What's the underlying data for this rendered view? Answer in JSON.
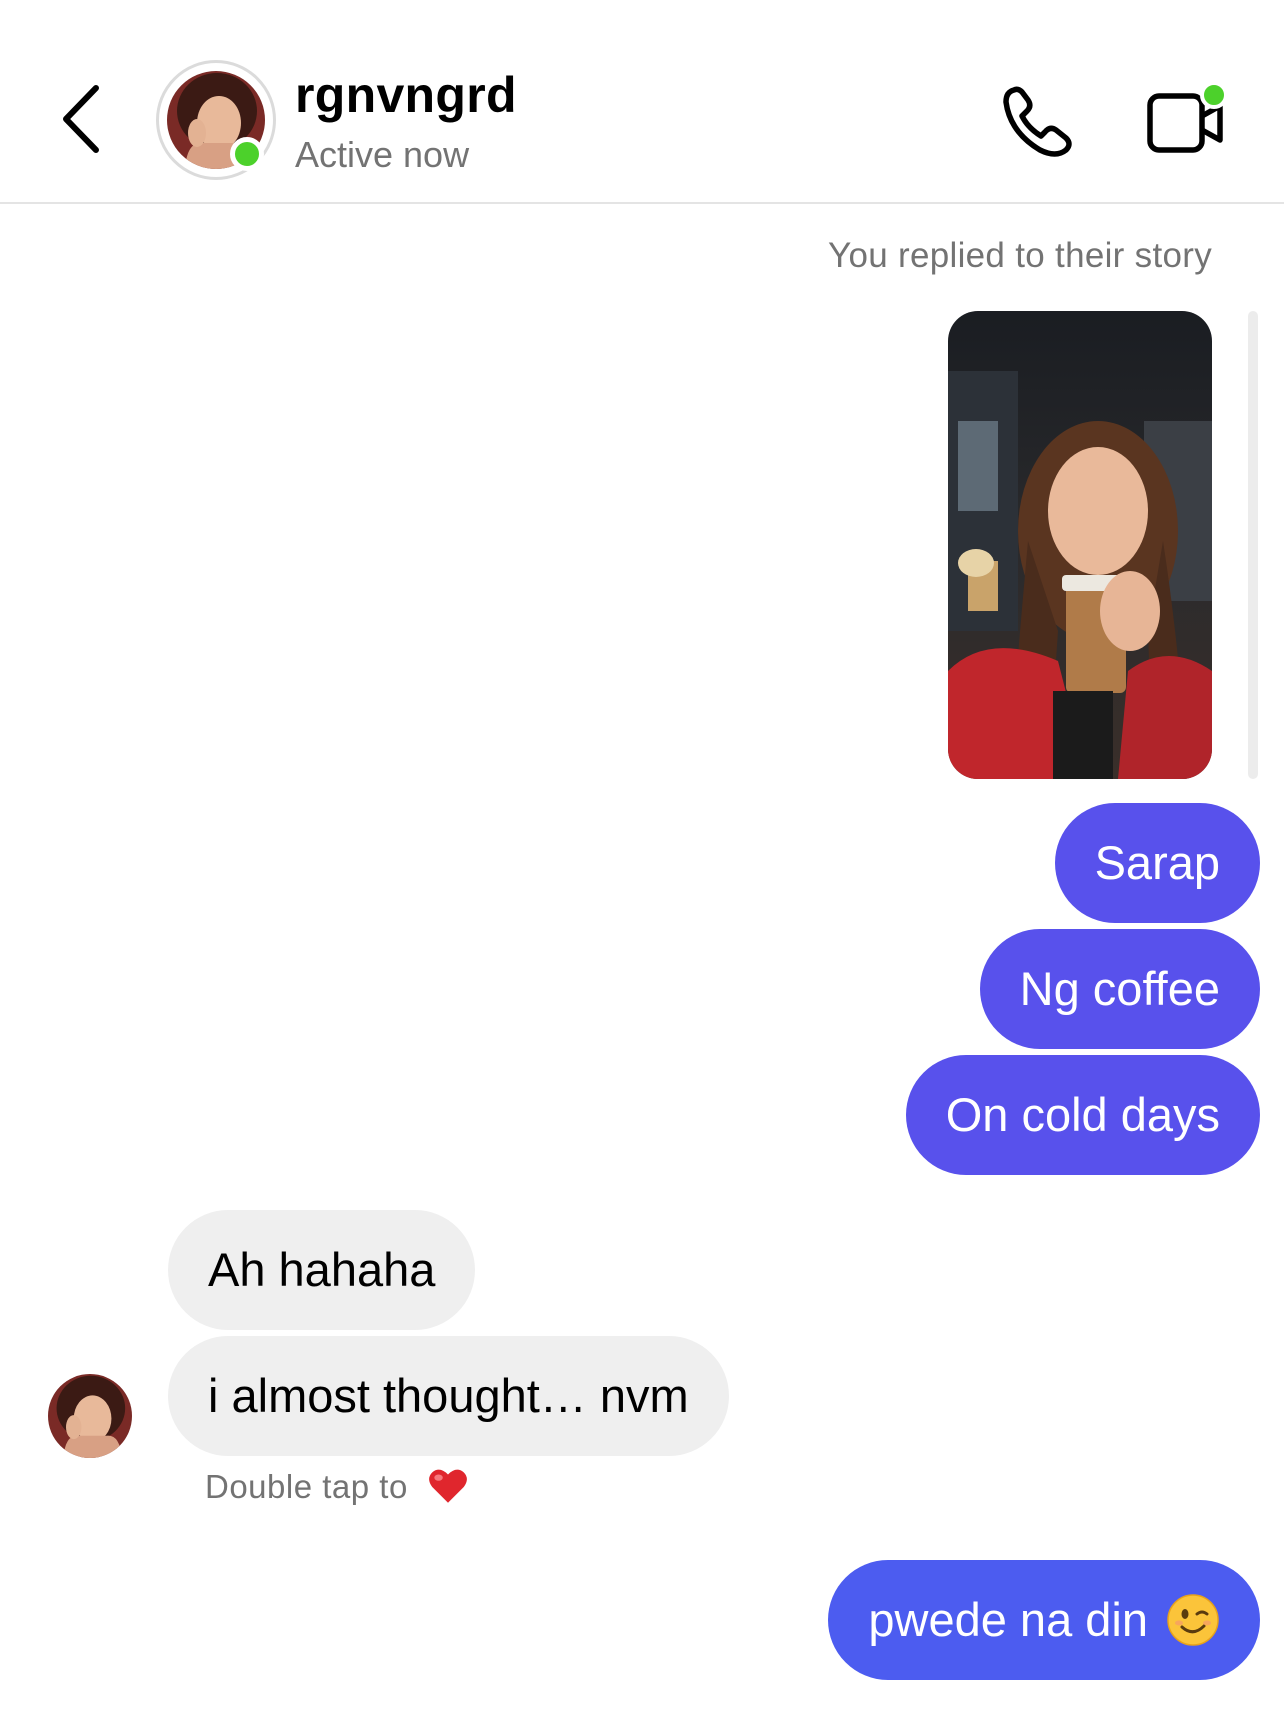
{
  "header": {
    "username": "rgnvngrd",
    "status": "Active now",
    "back_icon": "chevron-left-icon",
    "call_icon": "phone-icon",
    "video_icon": "video-camera-icon"
  },
  "thread": {
    "story_reply_label": "You replied to their story",
    "messages": [
      {
        "from": "me",
        "text": "Sarap"
      },
      {
        "from": "me",
        "text": "Ng coffee"
      },
      {
        "from": "me",
        "text": "On cold days"
      },
      {
        "from": "them",
        "text": "Ah hahaha"
      },
      {
        "from": "them",
        "text": "i almost thought… nvm"
      },
      {
        "from": "me",
        "text": "pwede na din",
        "emoji": "winking-face"
      }
    ],
    "double_tap_hint": "Double tap to",
    "hint_icon": "heart-icon"
  },
  "colors": {
    "outgoing": "#5851ec",
    "outgoing_latest": "#4c5cf0",
    "incoming": "#efefef",
    "online": "#4cd12b"
  }
}
